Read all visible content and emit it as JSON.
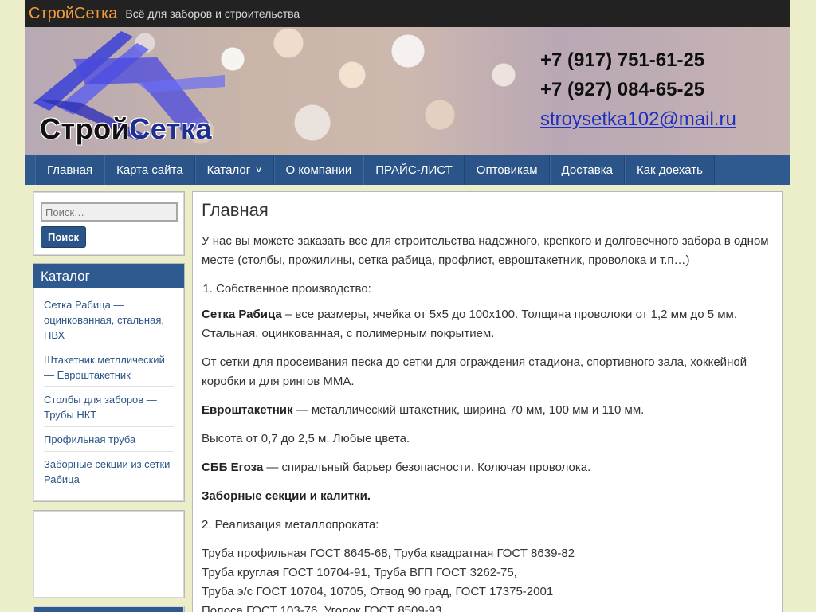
{
  "header": {
    "site_title": "СтройСетка",
    "site_desc": "Всё для заборов и строительства",
    "brand_part1": "Строй",
    "brand_part2": "Сетка",
    "phone1": "+7 (917) 751-61-25",
    "phone2": "+7 (927) 084-65-25",
    "email": "stroysetka102@mail.ru"
  },
  "nav": {
    "items": [
      {
        "label": "Главная"
      },
      {
        "label": "Карта сайта"
      },
      {
        "label": "Каталог"
      },
      {
        "label": "О компании"
      },
      {
        "label": "ПРАЙС-ЛИСТ"
      },
      {
        "label": "Оптовикам"
      },
      {
        "label": "Доставка"
      },
      {
        "label": "Как доехать"
      }
    ]
  },
  "search": {
    "placeholder": "Поиск…",
    "button_label": "Поиск"
  },
  "catalog": {
    "title": "Каталог",
    "items": [
      {
        "label": "Сетка Рабица — оцинкованная, стальная, ПВХ"
      },
      {
        "label": "Штакетник метллический — Евроштакетник"
      },
      {
        "label": "Столбы для заборов — Трубы НКТ"
      },
      {
        "label": "Профильная труба"
      },
      {
        "label": "Заборные секции из сетки Рабица"
      }
    ]
  },
  "content": {
    "title": "Главная",
    "intro": "У нас вы можете заказать все для строительства надежного, крепкого и долговечного забора в одном месте (столбы, прожилины, сетка рабица, профлист, евроштакетник, проволока и т.п…)",
    "list_item1": "Собственное производство:",
    "p1_bold": "Сетка Рабица",
    "p1_text": " – все размеры, ячейка от 5х5 до 100х100. Толщина проволоки от 1,2 мм до 5 мм. Стальная, оцинкованная, с полимерным покрытием.",
    "p2": "От сетки для просеивания песка до сетки для ограждения стадиона, спортивного зала, хоккейной коробки и для рингов ММА.",
    "p3_bold": "Евроштакетник",
    "p3_text": " — металлический штакетник, ширина 70 мм, 100 мм и 110 мм.",
    "p4": "Высота от 0,7 до 2,5 м. Любые цвета.",
    "p5_bold": "СББ Егоза",
    "p5_text": " — спиральный барьер безопасности. Колючая проволока.",
    "p6_bold": "Заборные секции и калитки.",
    "p7": "2. Реализация металлопроката:",
    "lines": [
      "Труба профильная ГОСТ 8645-68, Труба квадратная ГОСТ 8639-82",
      "Труба круглая ГОСТ 10704-91, Труба ВГП ГОСТ 3262-75,",
      "Труба э/с ГОСТ 10704, 10705, Отвод 90 град, ГОСТ 17375-2001",
      "Полоса ГОСТ 103-76, Уголок ГОСТ 8509-93"
    ]
  }
}
